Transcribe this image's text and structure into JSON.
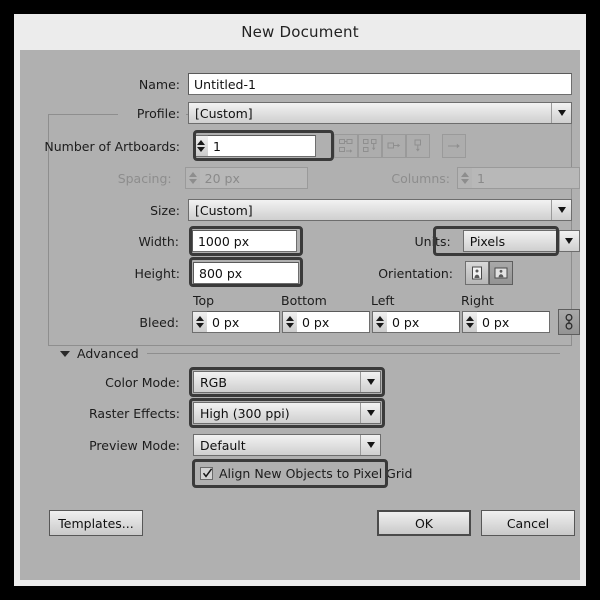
{
  "window": {
    "title": "New Document"
  },
  "fields": {
    "name_label": "Name:",
    "name_value": "Untitled-1",
    "profile_label": "Profile:",
    "profile_value": "[Custom]",
    "artboards_label": "Number of Artboards:",
    "artboards_value": "1",
    "spacing_label": "Spacing:",
    "spacing_value": "20 px",
    "columns_label": "Columns:",
    "columns_value": "1",
    "size_label": "Size:",
    "size_value": "[Custom]",
    "width_label": "Width:",
    "width_value": "1000 px",
    "height_label": "Height:",
    "height_value": "800 px",
    "units_label": "Units:",
    "units_value": "Pixels",
    "orientation_label": "Orientation:",
    "bleed_label": "Bleed:",
    "bleed_top_header": "Top",
    "bleed_bottom_header": "Bottom",
    "bleed_left_header": "Left",
    "bleed_right_header": "Right",
    "bleed_top_value": "0 px",
    "bleed_bottom_value": "0 px",
    "bleed_left_value": "0 px",
    "bleed_right_value": "0 px"
  },
  "advanced": {
    "section_title": "Advanced",
    "color_mode_label": "Color Mode:",
    "color_mode_value": "RGB",
    "raster_effects_label": "Raster Effects:",
    "raster_effects_value": "High (300 ppi)",
    "preview_mode_label": "Preview Mode:",
    "preview_mode_value": "Default",
    "align_pixel_grid_label": "Align New Objects to Pixel Grid",
    "align_pixel_grid_checked": true
  },
  "icons": {
    "artboard_grid_by_row": "grid-by-row-icon",
    "artboard_grid_by_column": "grid-by-column-icon",
    "artboard_arrange_by_row": "arrange-by-row-icon",
    "artboard_arrange_by_column": "arrange-by-column-icon",
    "artboard_flow_direction": "flow-direction-right-icon",
    "orientation_portrait": "portrait-icon",
    "orientation_landscape": "landscape-icon",
    "bleed_link": "link-chain-icon",
    "advanced_disclosure": "triangle-down-icon"
  },
  "footer": {
    "templates_label": "Templates...",
    "ok_label": "OK",
    "cancel_label": "Cancel"
  },
  "colors": {
    "outer": "#000000",
    "titlebar": "#ececec",
    "panel": "#b0b0b0",
    "field": "#ffffff",
    "focus_ring": "#3a3a3a"
  }
}
